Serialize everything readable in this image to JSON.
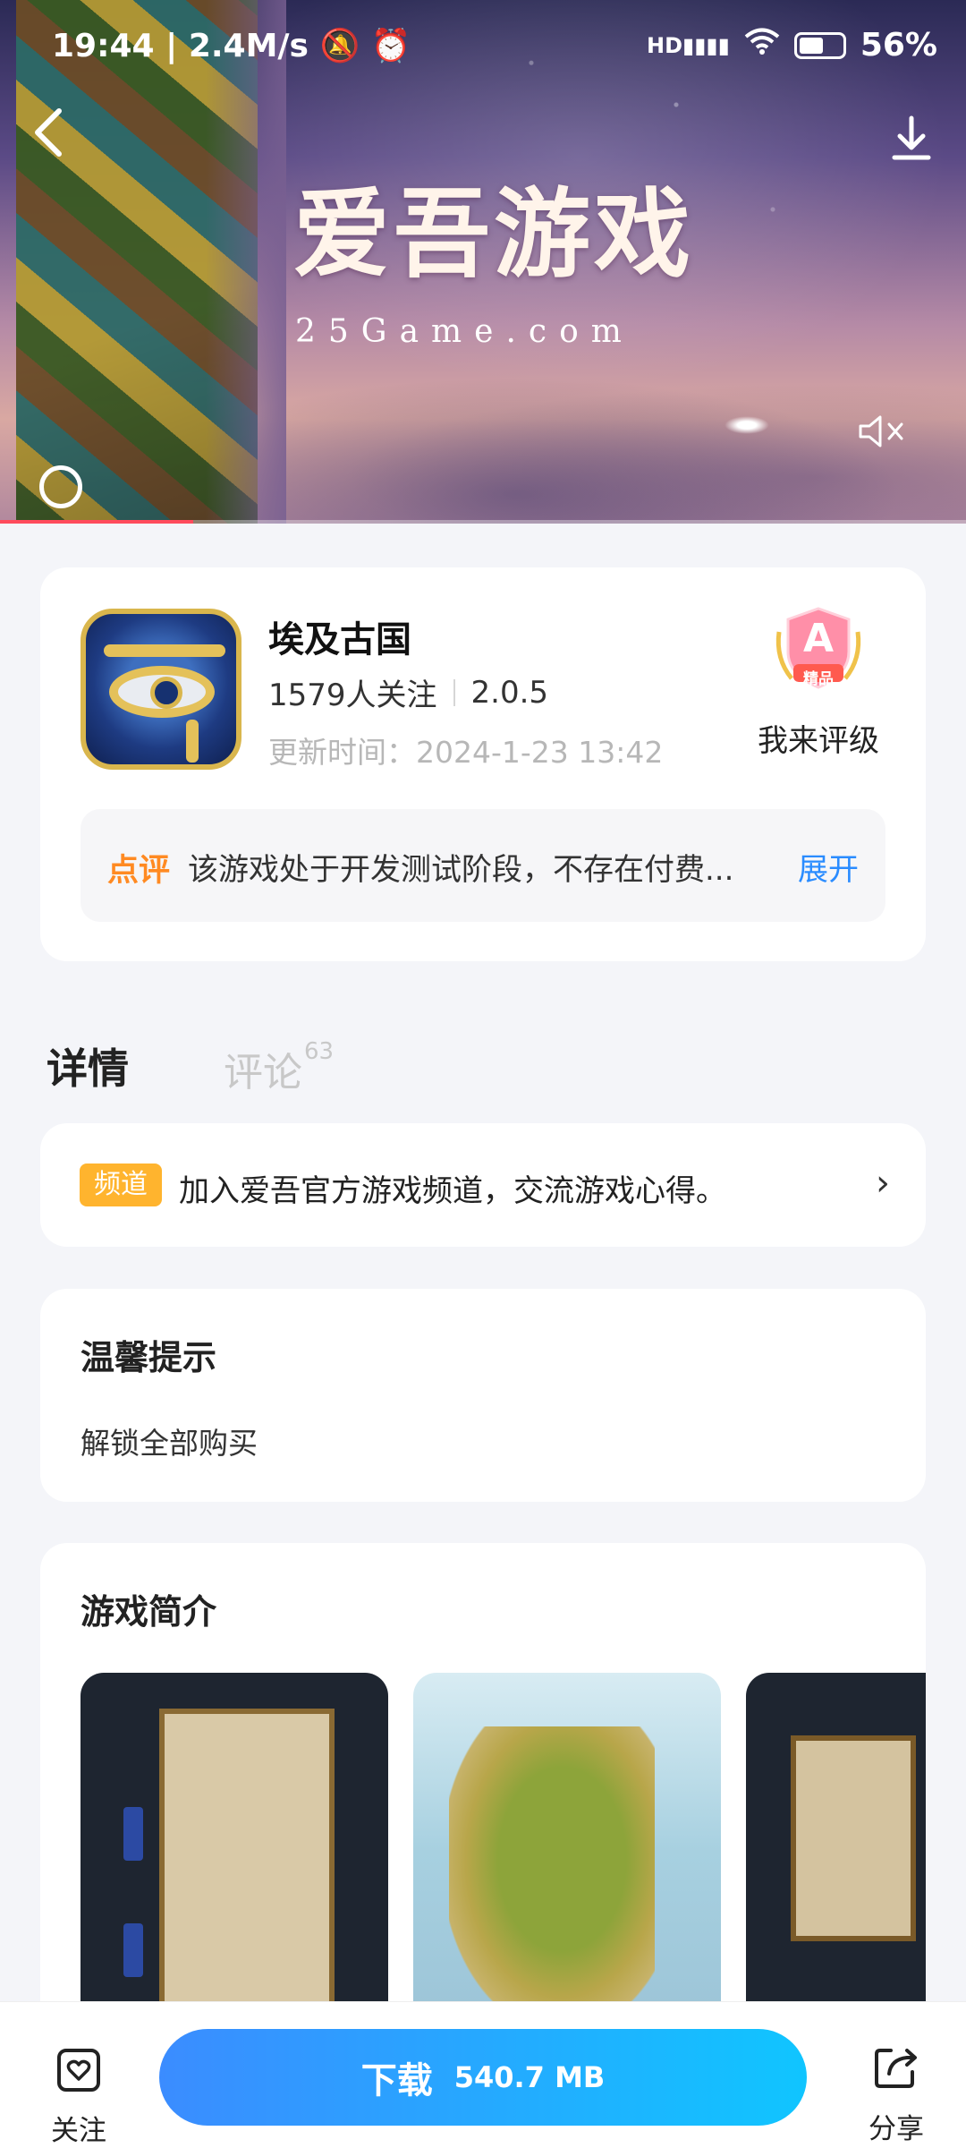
{
  "status_bar": {
    "time": "19:44",
    "speed": "2.4M/s",
    "network": "HD",
    "battery": "56%"
  },
  "video": {
    "watermark_title": "爱吾游戏",
    "watermark_url": "25Game.com",
    "progress": 0.2
  },
  "app": {
    "name": "埃及古国",
    "followers": "1579人关注",
    "version": "2.0.5",
    "updated": "更新时间：2024-1-23 13:42",
    "rating_grade": "A",
    "rating_tag": "精品",
    "rating_label": "我来评级"
  },
  "review": {
    "tag": "点评",
    "text": "该游戏处于开发测试阶段，不存在付费...",
    "expand_label": "展开"
  },
  "tabs": {
    "detail": "详情",
    "comments": "评论",
    "comments_count": "63"
  },
  "channel": {
    "tag": "频道",
    "text": "加入爱吾官方游戏频道，交流游戏心得。"
  },
  "tips": {
    "title": "温馨提示",
    "body": "解锁全部购买"
  },
  "intro": {
    "title": "游戏简介"
  },
  "bottom_bar": {
    "follow_label": "关注",
    "download_label": "下载",
    "download_size": "540.7 MB",
    "share_label": "分享"
  },
  "colors": {
    "accent_blue": "#2a8cff",
    "review_orange": "#ff8a22",
    "channel_tag": "#ffb42e",
    "download_gradient_start": "#3b8cff",
    "download_gradient_end": "#10c5ff"
  }
}
